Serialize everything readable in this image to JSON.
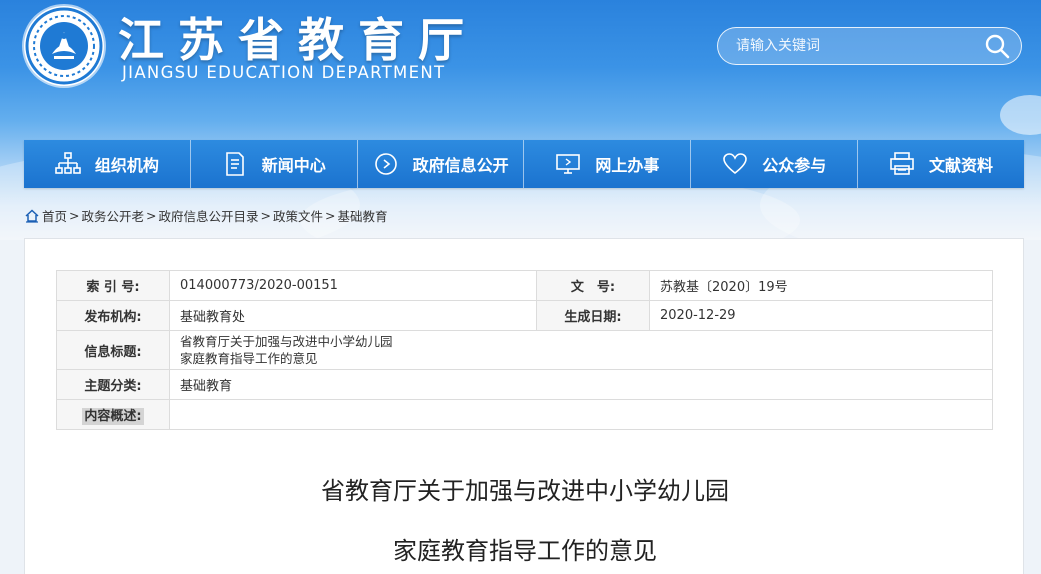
{
  "header": {
    "title": "江苏省教育厅",
    "subtitle": "JIANGSU EDUCATION DEPARTMENT",
    "search_placeholder": "请输入关键词"
  },
  "nav": [
    {
      "label": "组织机构",
      "icon": "org-chart-icon"
    },
    {
      "label": "新闻中心",
      "icon": "document-list-icon"
    },
    {
      "label": "政府信息公开",
      "icon": "play-circle-icon"
    },
    {
      "label": "网上办事",
      "icon": "monitor-icon"
    },
    {
      "label": "公众参与",
      "icon": "heart-icon"
    },
    {
      "label": "文献资料",
      "icon": "printer-icon"
    }
  ],
  "breadcrumb": [
    "首页",
    "政务公开老",
    "政府信息公开目录",
    "政策文件",
    "基础教育"
  ],
  "meta": {
    "index_label": "索 引 号:",
    "index_value": "014000773/2020-00151",
    "docno_label": "文　号:",
    "docno_value": "苏教基〔2020〕19号",
    "publisher_label": "发布机构:",
    "publisher_value": "基础教育处",
    "date_label": "生成日期:",
    "date_value": "2020-12-29",
    "infotitle_label": "信息标题:",
    "infotitle_line1": "省教育厅关于加强与改进中小学幼儿园",
    "infotitle_line2": "家庭教育指导工作的意见",
    "topic_label": "主题分类:",
    "topic_value": "基础教育",
    "summary_label": "内容概述:",
    "summary_value": ""
  },
  "article": {
    "title_line1": "省教育厅关于加强与改进中小学幼儿园",
    "title_line2": "家庭教育指导工作的意见"
  },
  "colors": {
    "nav_blue": "#1f7ad4",
    "banner_top": "#2a82dd",
    "link_blue": "#1a5fb4"
  }
}
